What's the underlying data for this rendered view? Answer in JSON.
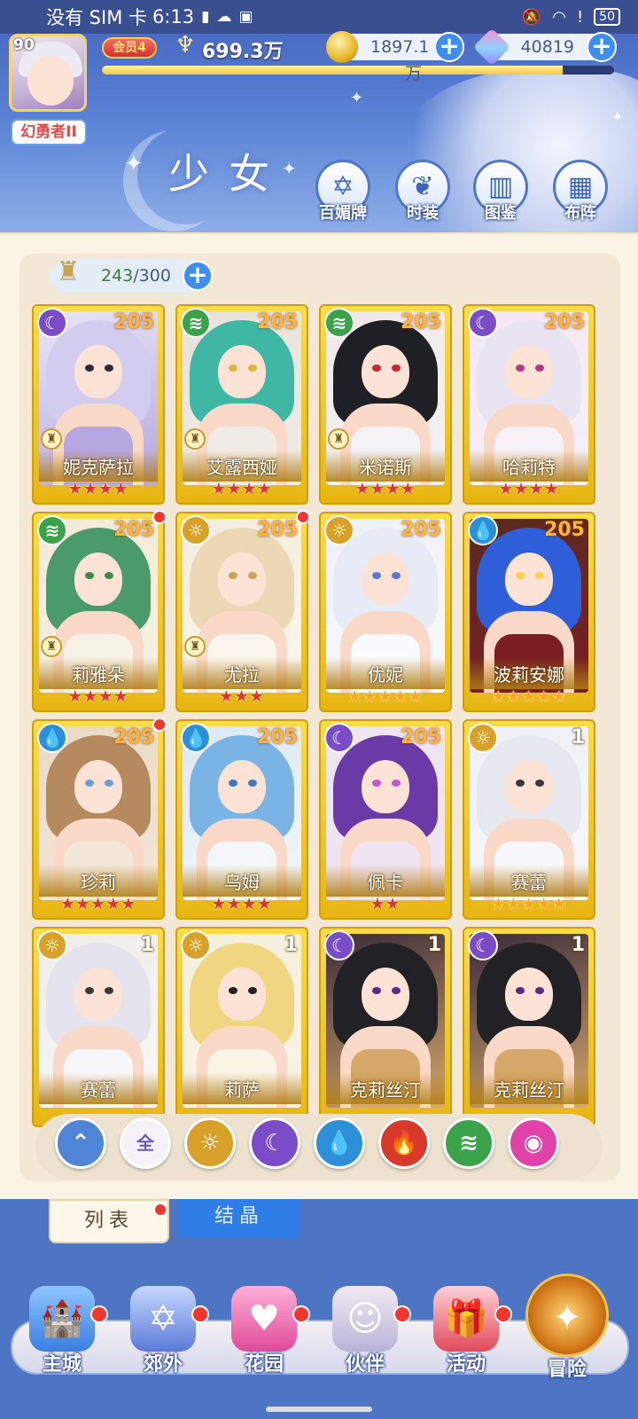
{
  "status_bar": {
    "carrier": "没有 SIM 卡",
    "time": "6:13",
    "battery": "50"
  },
  "header": {
    "player_level": "90",
    "player_title": "幻勇者II",
    "vip_label": "会员4",
    "power": "699.3万",
    "exp_fraction": 0.9,
    "gold": "1897.1万",
    "gems": "40819",
    "page_title": "少女",
    "buttons": [
      {
        "label": "百媚牌",
        "icon": "badge-icon"
      },
      {
        "label": "时装",
        "icon": "fashion-icon"
      },
      {
        "label": "图鉴",
        "icon": "book-icon"
      },
      {
        "label": "布阵",
        "icon": "grid-icon"
      }
    ]
  },
  "capacity": {
    "current": "243",
    "max": "/300"
  },
  "cards": [
    {
      "name": "妮克萨拉",
      "level": "205",
      "element": "moon",
      "stars": "★★★★",
      "star_color": "red",
      "chess": true,
      "dot": false,
      "palette": [
        "#e9e6f7",
        "#d2cdee",
        "#b6a7e0",
        "#2d2a3a"
      ]
    },
    {
      "name": "艾露西娅",
      "level": "205",
      "element": "wind",
      "stars": "★★★★",
      "star_color": "red",
      "chess": true,
      "dot": false,
      "palette": [
        "#e6e2dc",
        "#3fb7a4",
        "#f1ece6",
        "#d6b842"
      ]
    },
    {
      "name": "米诺斯",
      "level": "205",
      "element": "wind",
      "stars": "★★★★",
      "star_color": "red",
      "chess": true,
      "dot": false,
      "palette": [
        "#f2e9e9",
        "#1f1f26",
        "#f3f2f6",
        "#c7263b"
      ]
    },
    {
      "name": "哈莉特",
      "level": "205",
      "element": "moon",
      "stars": "★★★★",
      "star_color": "red",
      "chess": false,
      "dot": false,
      "palette": [
        "#f5e7f4",
        "#e9e4f2",
        "#f7f1f8",
        "#b03a8a"
      ]
    },
    {
      "name": "莉雅朵",
      "level": "205",
      "element": "wind",
      "stars": "★★★★",
      "star_color": "red",
      "chess": true,
      "dot": true,
      "palette": [
        "#f4ead8",
        "#4a9a6a",
        "#f6f2e7",
        "#3a8a4a"
      ]
    },
    {
      "name": "尤拉",
      "level": "205",
      "element": "sun",
      "stars": "★★★",
      "star_color": "red",
      "chess": true,
      "dot": true,
      "palette": [
        "#f4ece0",
        "#ecd8b4",
        "#fbf6ed",
        "#c9a454"
      ]
    },
    {
      "name": "优妮",
      "level": "205",
      "element": "sun",
      "stars": "★★★★★",
      "star_color": "gold",
      "chess": false,
      "dot": false,
      "palette": [
        "#eef0f8",
        "#e7ebf6",
        "#fafbff",
        "#5a7ad0"
      ]
    },
    {
      "name": "波莉安娜",
      "level": "205",
      "element": "water",
      "stars": "★★★★★",
      "star_color": "gold",
      "chess": false,
      "dot": false,
      "palette": [
        "#5a2a22",
        "#2f5fd8",
        "#7a1e22",
        "#ffcf4a"
      ]
    },
    {
      "name": "珍莉",
      "level": "205",
      "element": "water",
      "stars": "★★★★★",
      "star_color": "red",
      "chess": false,
      "dot": true,
      "palette": [
        "#ead9c4",
        "#b58a5e",
        "#f3e7da",
        "#6aa0d8"
      ]
    },
    {
      "name": "乌姆",
      "level": "205",
      "element": "water",
      "stars": "★★★★",
      "star_color": "red",
      "chess": false,
      "dot": false,
      "palette": [
        "#dce8f4",
        "#7ab4e4",
        "#f4f7fb",
        "#3a7ac8"
      ]
    },
    {
      "name": "佩卡",
      "level": "205",
      "element": "moon",
      "stars": "★★",
      "star_color": "red",
      "chess": false,
      "dot": false,
      "palette": [
        "#efe6f2",
        "#6a3aa6",
        "#f0e3f2",
        "#c05ad0"
      ]
    },
    {
      "name": "赛蕾",
      "level": "1",
      "element": "sun",
      "stars": "★★★★★",
      "star_color": "gold",
      "chess": false,
      "dot": false,
      "palette": [
        "#eef0f5",
        "#e8e8f0",
        "#f8f8fb",
        "#3a3a3a"
      ]
    },
    {
      "name": "赛蕾",
      "level": "1",
      "element": "sun",
      "stars": "",
      "star_color": "gold",
      "chess": false,
      "dot": false,
      "palette": [
        "#f0ede8",
        "#e5e4ee",
        "#f8f8fb",
        "#3a3a3a"
      ]
    },
    {
      "name": "莉萨",
      "level": "1",
      "element": "sun",
      "stars": "",
      "star_color": "gold",
      "chess": false,
      "dot": false,
      "palette": [
        "#f6efdc",
        "#f0d680",
        "#faf4e6",
        "#222222"
      ]
    },
    {
      "name": "克莉丝汀",
      "level": "1",
      "element": "moon",
      "stars": "",
      "star_color": "gold",
      "chess": false,
      "dot": false,
      "palette": [
        "#3a2a3a",
        "#222226",
        "#d6a86a",
        "#5a2a8a"
      ]
    },
    {
      "name": "克莉丝汀",
      "level": "1",
      "element": "moon",
      "stars": "",
      "star_color": "gold",
      "chess": false,
      "dot": false,
      "palette": [
        "#3a2a3a",
        "#222226",
        "#d6a86a",
        "#5a2a8a"
      ]
    }
  ],
  "filters": [
    {
      "key": "wings",
      "label": "",
      "color": "#4f84d6"
    },
    {
      "key": "all",
      "label": "全",
      "color": "#f4f2f6"
    },
    {
      "key": "sun",
      "label": "",
      "color": "#d8a12a"
    },
    {
      "key": "moon",
      "label": "",
      "color": "#7a4cc8"
    },
    {
      "key": "water",
      "label": "",
      "color": "#2c8fd8"
    },
    {
      "key": "fire",
      "label": "",
      "color": "#d8392a"
    },
    {
      "key": "wind",
      "label": "",
      "color": "#3aa34a"
    },
    {
      "key": "light",
      "label": "",
      "color": "#e042a8"
    }
  ],
  "tabs": {
    "list": "列表",
    "crystal": "结晶"
  },
  "nav": [
    {
      "label": "主城",
      "icon": "castle-icon",
      "dot": true
    },
    {
      "label": "郊外",
      "icon": "compass-star-icon",
      "dot": true
    },
    {
      "label": "花园",
      "icon": "heart-icon",
      "dot": true
    },
    {
      "label": "伙伴",
      "icon": "partner-avatar-icon",
      "dot": true
    },
    {
      "label": "活动",
      "icon": "gift-icon",
      "dot": true
    },
    {
      "label": "冒险",
      "icon": "sword-compass-icon",
      "dot": false
    }
  ]
}
